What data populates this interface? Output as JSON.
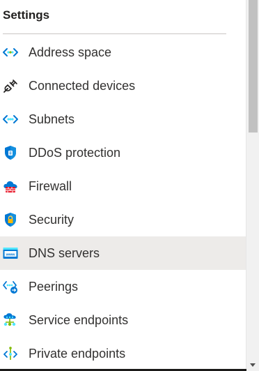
{
  "section": {
    "title": "Settings"
  },
  "menu": {
    "items": [
      {
        "label": "Address space",
        "icon": "address-space-icon"
      },
      {
        "label": "Connected devices",
        "icon": "plug-icon"
      },
      {
        "label": "Subnets",
        "icon": "subnets-icon"
      },
      {
        "label": "DDoS protection",
        "icon": "shield-icon"
      },
      {
        "label": "Firewall",
        "icon": "firewall-icon"
      },
      {
        "label": "Security",
        "icon": "security-lock-icon"
      },
      {
        "label": "DNS servers",
        "icon": "www-icon",
        "selected": true
      },
      {
        "label": "Peerings",
        "icon": "peerings-icon"
      },
      {
        "label": "Service endpoints",
        "icon": "service-endpoints-icon"
      },
      {
        "label": "Private endpoints",
        "icon": "private-endpoints-icon"
      }
    ]
  },
  "colors": {
    "selected_bg": "#edebe9",
    "azure_blue": "#0078d4",
    "azure_cyan": "#50e6ff",
    "text": "#323130"
  }
}
